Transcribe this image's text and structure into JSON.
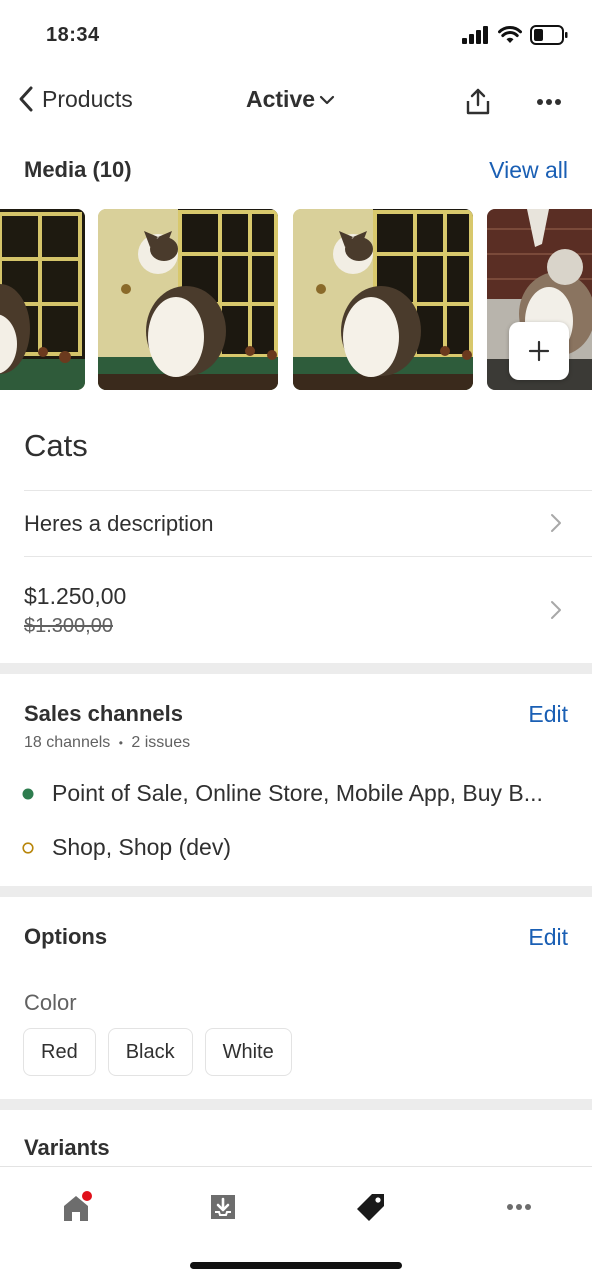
{
  "status_bar": {
    "time": "18:34"
  },
  "nav": {
    "back_label": "Products",
    "title": "Active"
  },
  "media": {
    "heading": "Media (10)",
    "view_all": "View all"
  },
  "product": {
    "title": "Cats",
    "description": "Heres a description",
    "price": "$1.250,00",
    "compare_price": "$1.300,00"
  },
  "sales_channels": {
    "heading": "Sales channels",
    "edit": "Edit",
    "summary_count": "18 channels",
    "summary_separator": "•",
    "summary_issues": "2 issues",
    "active_channels": "Point of Sale, Online Store, Mobile App, Buy B...",
    "inactive_channels": "Shop, Shop (dev)"
  },
  "options": {
    "heading": "Options",
    "edit": "Edit",
    "option_name": "Color",
    "values": [
      "Red",
      "Black",
      "White"
    ]
  },
  "variants": {
    "heading": "Variants"
  },
  "colors": {
    "link": "#1a5fb4",
    "active_dot": "#2e7d4f",
    "inactive_dot": "#b8860b",
    "notification_dot": "#e0101a"
  }
}
